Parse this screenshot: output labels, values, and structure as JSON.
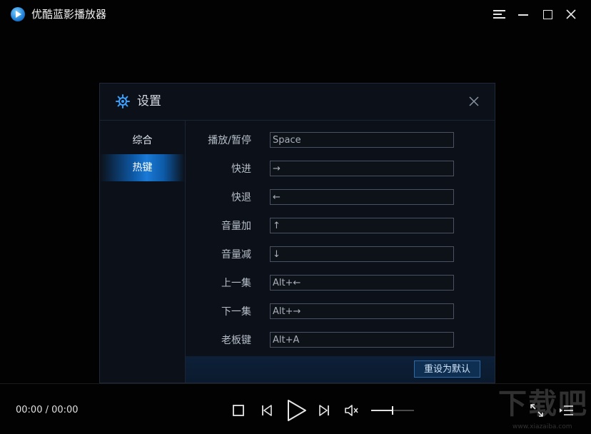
{
  "window": {
    "title": "优酷蓝影播放器"
  },
  "dialog": {
    "title": "设置",
    "sidebar": {
      "items": [
        {
          "label": "综合"
        },
        {
          "label": "热键"
        }
      ],
      "selected": "热键"
    },
    "hotkeys": [
      {
        "label": "播放/暂停",
        "value": "Space"
      },
      {
        "label": "快进",
        "value": "→"
      },
      {
        "label": "快退",
        "value": "←"
      },
      {
        "label": "音量加",
        "value": "↑"
      },
      {
        "label": "音量减",
        "value": "↓"
      },
      {
        "label": "上一集",
        "value": "Alt+←"
      },
      {
        "label": "下一集",
        "value": "Alt+→"
      },
      {
        "label": "老板键",
        "value": "Alt+A"
      }
    ],
    "reset_label": "重设为默认"
  },
  "player": {
    "time": "00:00 / 00:00",
    "volume_level": 0.5
  },
  "watermark": {
    "text": "下载吧",
    "sub": "www.xiazaiba.com"
  },
  "colors": {
    "accent": "#1a7ad6",
    "dialog_bg": "#0c1119",
    "background": "#020202"
  },
  "icons": [
    "app-logo-icon",
    "menu-icon",
    "minimize-icon",
    "maximize-icon",
    "close-icon",
    "gear-icon",
    "stop-icon",
    "previous-icon",
    "play-icon",
    "next-icon",
    "volume-icon",
    "fullscreen-icon",
    "playlist-icon"
  ]
}
